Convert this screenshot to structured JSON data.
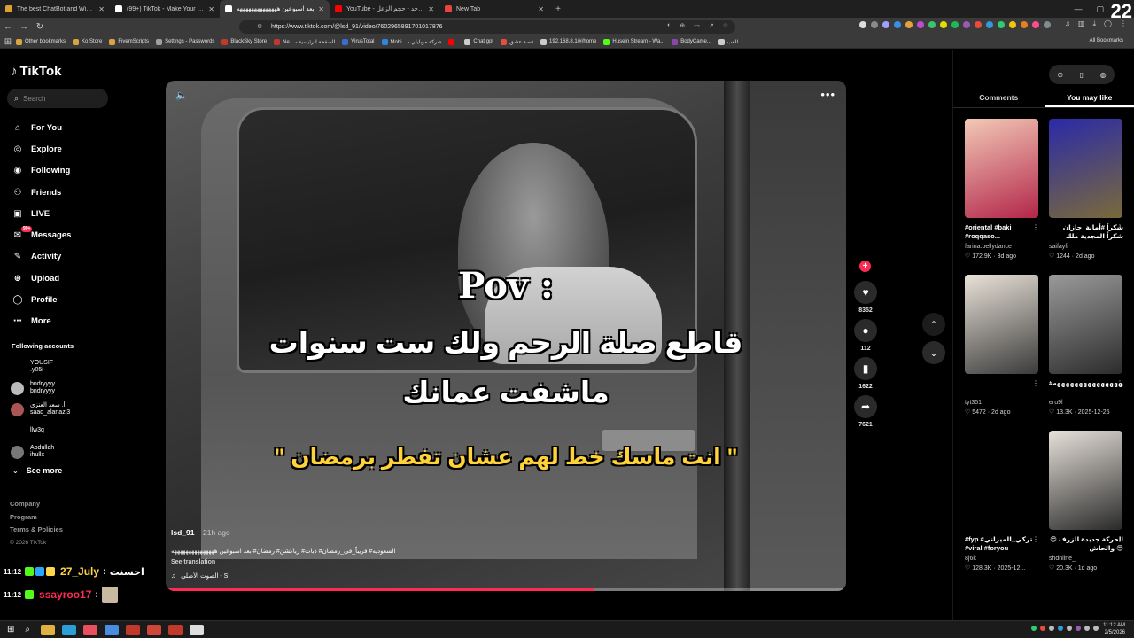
{
  "browser": {
    "tabs": [
      {
        "title": "The best ChatBot and Widgets for Kick",
        "color": "#e0a030",
        "active": false
      },
      {
        "title": "(99+) TikTok - Make Your Day",
        "color": "#ffffff",
        "active": false
      },
      {
        "title": "بعد اسبوعين ههههههههههههههه",
        "color": "#ffffff",
        "active": true
      },
      {
        "title": "YouTube - راشد الماجد - حجم الزعل",
        "color": "#ff0000",
        "active": false
      },
      {
        "title": "New Tab",
        "color": "#e8453c",
        "active": false
      }
    ],
    "new_tab": "+",
    "url": "https://www.tiktok.com/@lsd_91/video/7602965891701017876",
    "corner_badge": "22",
    "bookmarks": [
      {
        "label": "Other bookmarks",
        "color": "#d9a441"
      },
      {
        "label": "Ko Store",
        "color": "#d9a441"
      },
      {
        "label": "FivemScripts",
        "color": "#d9a441"
      },
      {
        "label": "Settings - Passwords",
        "color": "#9aa0a6"
      },
      {
        "label": "BlackSky Store",
        "color": "#c0392b"
      },
      {
        "label": "Ne... - الصفحة الرئيسية",
        "color": "#c0392b"
      },
      {
        "label": "VirusTotal",
        "color": "#3b6cd6"
      },
      {
        "label": "Mobi... - شركة موبايلي",
        "color": "#2e86de"
      },
      {
        "label": "",
        "color": "#ff0000"
      },
      {
        "label": "Chat gpt",
        "color": "#cccccc"
      },
      {
        "label": "قصة عشق",
        "color": "#e74c3c"
      },
      {
        "label": "192.168.8.1/#/home",
        "color": "#cccccc"
      },
      {
        "label": "Husein Stream - Wa...",
        "color": "#53fc18"
      },
      {
        "label": "BodyCame...",
        "color": "#8e44ad"
      },
      {
        "label": "العب",
        "color": "#cccccc"
      }
    ],
    "all_bookmarks": "All Bookmarks"
  },
  "tiktok": {
    "logo": "TikTok",
    "search_placeholder": "Search",
    "nav": [
      {
        "label": "For You",
        "icon": "home-icon",
        "glyph": "⌂"
      },
      {
        "label": "Explore",
        "icon": "compass-icon",
        "glyph": "◎"
      },
      {
        "label": "Following",
        "icon": "following-icon",
        "glyph": "◉"
      },
      {
        "label": "Friends",
        "icon": "friends-icon",
        "glyph": "⚇"
      },
      {
        "label": "LIVE",
        "icon": "live-icon",
        "glyph": "▣"
      },
      {
        "label": "Messages",
        "icon": "messages-icon",
        "glyph": "✉",
        "badge": "99+"
      },
      {
        "label": "Activity",
        "icon": "activity-icon",
        "glyph": "✎"
      },
      {
        "label": "Upload",
        "icon": "upload-icon",
        "glyph": "⊕"
      },
      {
        "label": "Profile",
        "icon": "profile-icon",
        "glyph": "◯"
      },
      {
        "label": "More",
        "icon": "more-icon",
        "glyph": "⋯"
      }
    ],
    "following_title": "Following accounts",
    "following_accounts": [
      {
        "line1": "YOUSIF",
        "line2": ".y05i",
        "color": "#000000"
      },
      {
        "line1": "bndryyyy",
        "line2": "bndryyyy",
        "color": "#bbbbbb"
      },
      {
        "line1": "أ. سعد العنزي",
        "line2": "saad_alanazi3",
        "color": "#aa5555"
      },
      {
        "line1": "",
        "line2": "llw3q",
        "color": "#000000"
      },
      {
        "line1": "Abdullah",
        "line2": "ihullx",
        "color": "#777777"
      }
    ],
    "see_more": "See more",
    "footer": {
      "company": "Company",
      "program": "Program",
      "terms": "Terms & Policies",
      "copyright": "© 2026 TikTok"
    }
  },
  "chat": [
    {
      "time": "11:12",
      "user": "27_July",
      "sep": " : ",
      "msg": "احسنت",
      "user_color": "#ffd54a"
    },
    {
      "time": "11:12",
      "user": "ssayroo17",
      "sep": " : ",
      "msg": "",
      "user_color": "#fe2c55"
    }
  ],
  "video": {
    "caption_pov": "Pov :",
    "caption_main_1": "قاطع صلة الرحم ولك ست سنوات",
    "caption_main_2": "ماشفت عمانك",
    "caption_quote": "\" انت ماسك خط لهم عشان تفطر برمضان \"",
    "author": "lsd_91",
    "posted": "· 21h ago",
    "description": "السعوديه# قريباً_في_رمضان# ذبات# رياكشن# رمضان# بعد اسبوعين هههههههههههههههه",
    "see_translation": "See translation",
    "music": "الصوت الأصلي - S",
    "progress": 0.63
  },
  "actions": {
    "likes": "8352",
    "comments": "112",
    "saves": "1622",
    "shares": "7621"
  },
  "right_panel": {
    "tabs": [
      "Comments",
      "You may like"
    ],
    "active_tab": "You may like",
    "cards": [
      {
        "caption": "#oriental #baki #roqqaso...",
        "user": "farina.bellydance",
        "likes": "172.9K",
        "date": "3d ago",
        "rtl": false,
        "c1": "#f2c9b6",
        "c2": "#b3264a"
      },
      {
        "caption": "شكراً #أمانة_جازان شكراً المجدية ملك محافظة فيفاء",
        "user": "saifayfi",
        "likes": "1244",
        "date": "2d ago",
        "rtl": true,
        "c1": "#2a2aa8",
        "c2": "#7a6a3a"
      },
      {
        "caption": "",
        "user": "tyt351",
        "likes": "5472",
        "date": "2d ago",
        "rtl": false,
        "c1": "#e9e2d8",
        "c2": "#3b3b3b"
      },
      {
        "caption": "#ههههههههههههههههههههه",
        "user": "eru9l",
        "likes": "13.3K",
        "date": "2025-12-25",
        "rtl": false,
        "c1": "#9a9a9a",
        "c2": "#2c2c2c"
      },
      {
        "caption": "#fyp #تركي_الميزاني #viral #foryou",
        "user": "8j6k",
        "likes": "128.3K",
        "date": "2025-12...",
        "rtl": false,
        "c1": "#000000",
        "c2": "#000000"
      },
      {
        "caption": "الحركة جديدة الزرف 😍😍 والحاش",
        "user": "shdnline_",
        "likes": "20.3K",
        "date": "1d ago",
        "rtl": true,
        "c1": "#e7e1da",
        "c2": "#2a2a2a"
      }
    ]
  },
  "taskbar": {
    "time": "11:12 AM",
    "date": "2/5/2026"
  }
}
